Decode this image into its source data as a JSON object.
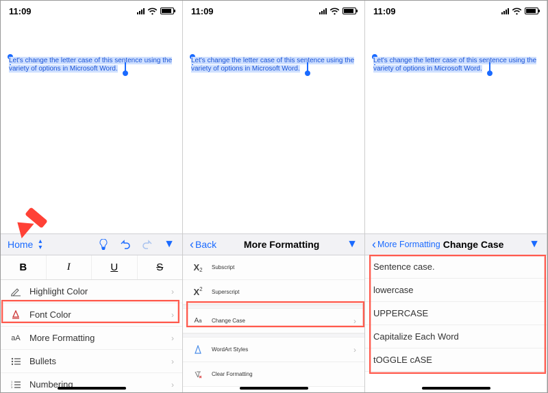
{
  "status": {
    "time": "11:09"
  },
  "document": {
    "selected_text": "Let's change the letter case of this sentence using the variety of options in Microsoft Word."
  },
  "screen1": {
    "tab_label": "Home",
    "format_buttons": {
      "bold": "B",
      "italic": "I",
      "underline": "U",
      "strike": "S"
    },
    "rows": {
      "highlight_color": "Highlight Color",
      "font_color": "Font Color",
      "more_formatting": "More Formatting",
      "bullets": "Bullets",
      "numbering": "Numbering"
    }
  },
  "screen2": {
    "back_label": "Back",
    "title": "More Formatting",
    "rows": {
      "subscript": "Subscript",
      "superscript": "Superscript",
      "change_case": "Change Case",
      "wordart": "WordArt Styles",
      "clear_formatting": "Clear Formatting"
    }
  },
  "screen3": {
    "back_label": "More Formatting",
    "title": "Change Case",
    "options": {
      "sentence": "Sentence case.",
      "lowercase": "lowercase",
      "uppercase": "UPPERCASE",
      "capitalize": "Capitalize Each Word",
      "toggle": "tOGGLE cASE"
    }
  }
}
